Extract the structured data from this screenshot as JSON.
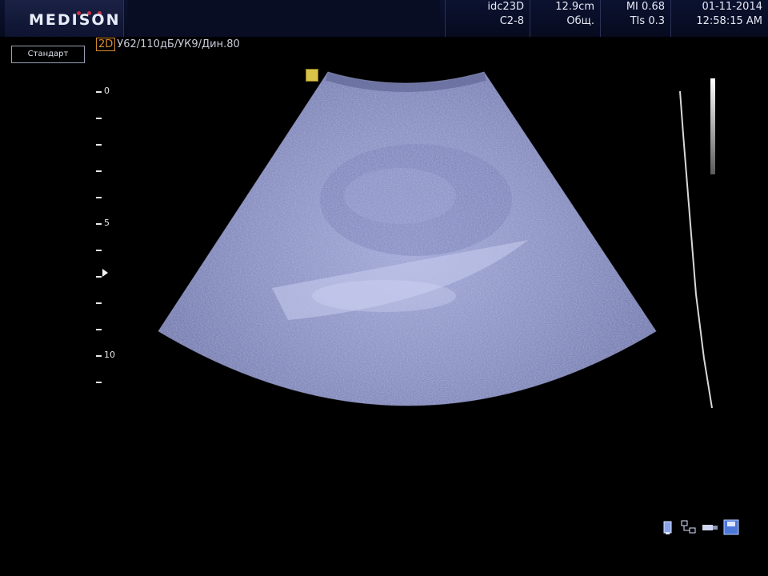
{
  "header": {
    "brand": "MEDISON",
    "probe": "idc23D",
    "application": "C2-8",
    "depth": "12.9cm",
    "exam_type": "Общ.",
    "mi_label": "MI",
    "mi_value": "0.68",
    "tis_label": "TIs",
    "tis_value": "0.3",
    "date": "01-11-2014",
    "time": "12:58:15 AM"
  },
  "imaging": {
    "mode": "2D",
    "params": "У62/110дБ/УК9/Дин.80",
    "preset": "Стандарт"
  },
  "depth_scale": {
    "labels": [
      "0",
      "5",
      "10"
    ]
  },
  "colors": {
    "background": "#000000",
    "accent_orange": "#d68b2f",
    "tissue": "#8d94c4"
  },
  "status_icons": [
    "probe-icon",
    "network-icon",
    "usb-icon",
    "save-icon"
  ]
}
